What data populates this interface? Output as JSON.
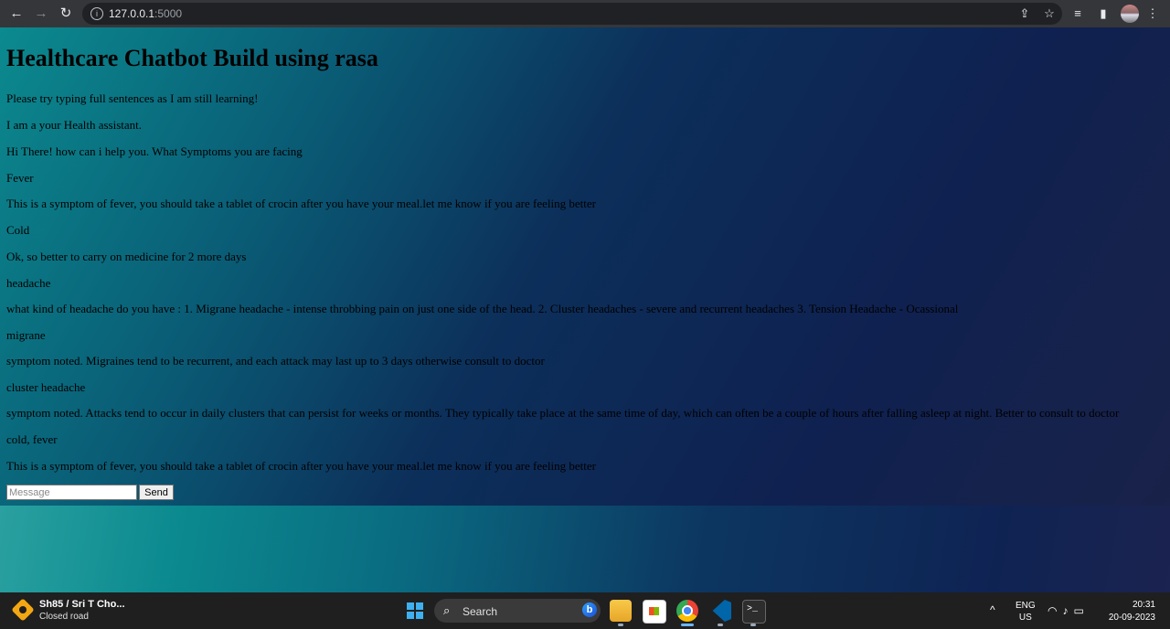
{
  "browser": {
    "url_host": "127.0.0.1",
    "url_port": ":5000"
  },
  "page": {
    "title": "Healthcare Chatbot Build using rasa",
    "messages": [
      "Please try typing full sentences as I am still learning!",
      "I am a your Health assistant.",
      "Hi There! how can i help you. What Symptoms you are facing",
      "Fever",
      "This is a symptom of fever, you should take a tablet of crocin after you have your meal.let me know if you are feeling better",
      "Cold",
      "Ok, so better to carry on medicine for 2 more days",
      "headache",
      "what kind of headache do you have : 1. Migrane headache - intense throbbing pain on just one side of the head. 2. Cluster headaches - severe and recurrent headaches 3. Tension Headache - Ocassional",
      "migrane",
      "symptom noted. Migraines tend to be recurrent, and each attack may last up to 3 days otherwise consult to doctor",
      "cluster headache",
      "symptom noted. Attacks tend to occur in daily clusters that can persist for weeks or months. They typically take place at the same time of day, which can often be a couple of hours after falling asleep at night. Better to consult to doctor",
      "cold, fever",
      "This is a symptom of fever, you should take a tablet of crocin after you have your meal.let me know if you are feeling better"
    ],
    "input_placeholder": "Message",
    "send_label": "Send"
  },
  "taskbar": {
    "weather_title": "Sh85 / Sri T Cho...",
    "weather_sub": "Closed road",
    "search_label": "Search",
    "lang_line1": "ENG",
    "lang_line2": "US",
    "time": "20:31",
    "date": "20-09-2023"
  }
}
